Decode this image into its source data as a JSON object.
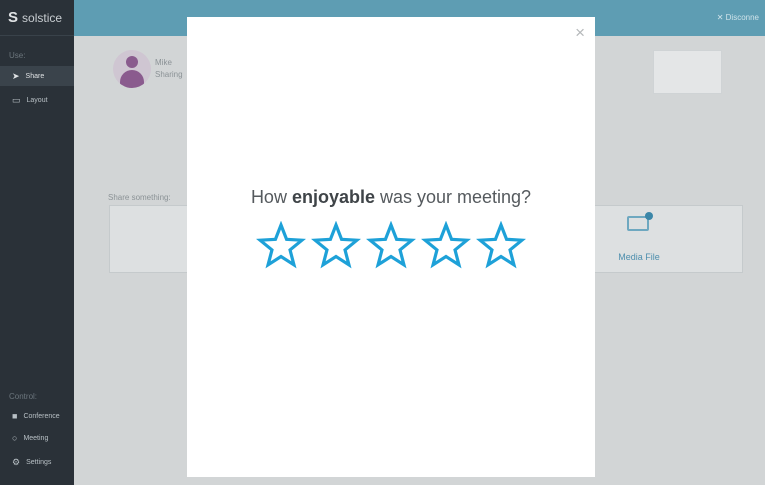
{
  "app": {
    "logo_text": "solstice",
    "logo_mark": "S"
  },
  "sidebar": {
    "use_label": "Use:",
    "items": [
      {
        "label": "Share",
        "icon": "send-icon",
        "active": true
      },
      {
        "label": "Layout",
        "icon": "monitor-icon",
        "active": false
      }
    ],
    "control_label": "Control:",
    "control_items": [
      {
        "label": "Conference",
        "icon": "camera-icon"
      },
      {
        "label": "Meeting",
        "icon": "clock-icon"
      },
      {
        "label": "Settings",
        "icon": "gear-icon"
      }
    ]
  },
  "topbar": {
    "disconnect_label": "✕ Disconne"
  },
  "user": {
    "name": "Mike",
    "status": "Sharing"
  },
  "share": {
    "label": "Share something:",
    "media_label": "Media File"
  },
  "modal": {
    "question_pre": "How ",
    "question_bold": "enjoyable",
    "question_post": " was your meeting?",
    "close_glyph": "×",
    "rating": {
      "max": 5,
      "value": 0
    }
  },
  "colors": {
    "accent": "#1ea1d8",
    "sidebar": "#2a3138",
    "topbar": "#5e9db3"
  }
}
